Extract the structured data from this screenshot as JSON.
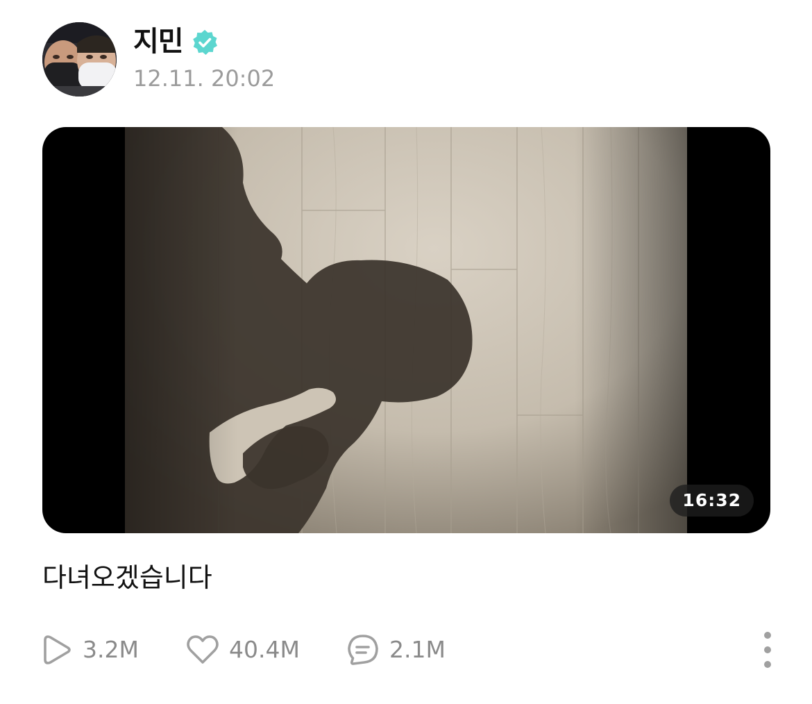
{
  "post": {
    "author": {
      "name": "지민",
      "verified": true,
      "verified_color": "#5cd6cf"
    },
    "timestamp": "12.11. 20:02",
    "media": {
      "type": "video",
      "duration": "16:32"
    },
    "caption": "다녀오겠습니다",
    "stats": {
      "views": "3.2M",
      "likes": "40.4M",
      "comments": "2.1M"
    }
  },
  "icons": {
    "views": "play-icon",
    "likes": "heart-icon",
    "comments": "comment-icon",
    "more": "more-vertical-icon",
    "verified": "verified-badge-icon"
  }
}
